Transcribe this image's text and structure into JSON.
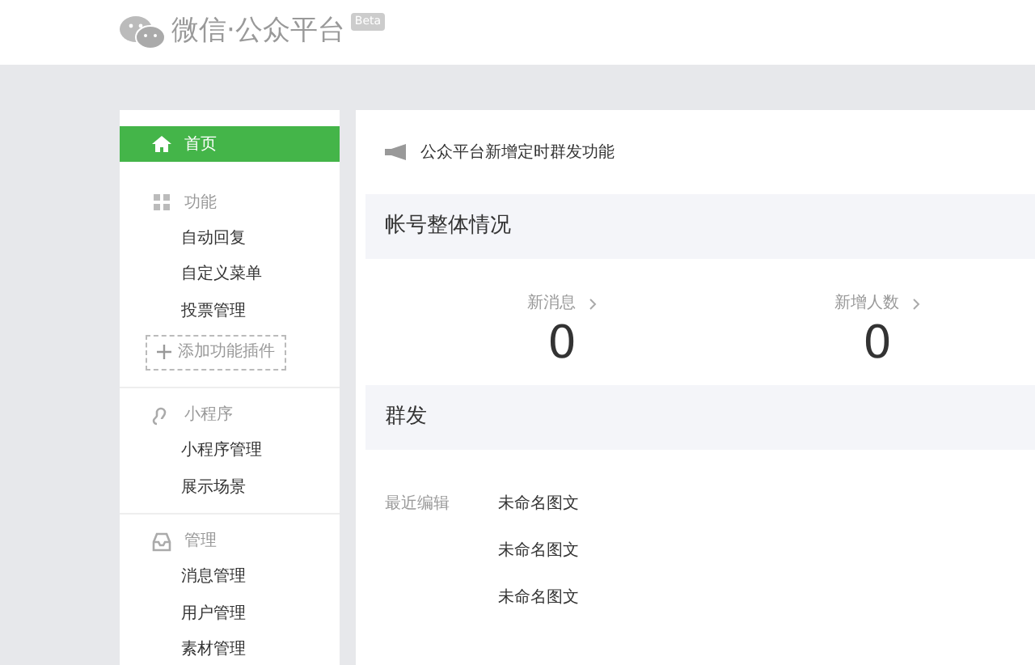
{
  "header": {
    "logo_text": "微信·公众平台",
    "badge": "Beta"
  },
  "sidebar": {
    "sections": [
      {
        "kind": "link",
        "label": "首页",
        "selected": true
      },
      {
        "kind": "group",
        "label": "功能",
        "items": [
          {
            "label": "自动回复",
            "selected": false
          },
          {
            "label": "自定义菜单",
            "selected": false
          },
          {
            "label": "投票管理",
            "selected": false
          }
        ],
        "add_button": "添加功能插件"
      },
      {
        "kind": "group",
        "label": "小程序",
        "items": [
          {
            "label": "小程序管理",
            "selected": false
          },
          {
            "label": "展示场景",
            "selected": false
          }
        ]
      },
      {
        "kind": "group",
        "label": "管理",
        "items": [
          {
            "label": "消息管理",
            "selected": false
          },
          {
            "label": "用户管理",
            "selected": false
          },
          {
            "label": "素材管理",
            "selected": false
          }
        ]
      }
    ]
  },
  "notice": "公众平台新增定时群发功能",
  "account_overview": {
    "title": "帐号整体情况",
    "stats": [
      {
        "label": "新消息",
        "value": "0"
      },
      {
        "label": "新增人数",
        "value": "0"
      }
    ]
  },
  "mass_send": {
    "title": "群发",
    "recent_label": "最近编辑",
    "drafts": [
      "未命名图文",
      "未命名图文",
      "未命名图文"
    ]
  }
}
